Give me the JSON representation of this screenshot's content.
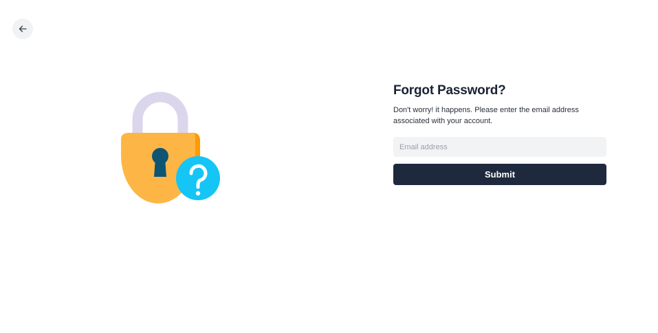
{
  "nav": {
    "back_icon": "arrow-left-icon"
  },
  "illustration": {
    "icon": "padlock-question-icon",
    "colors": {
      "shackle": "#dcd6ec",
      "body": "#fdb645",
      "body_shade": "#ff9a00",
      "keyhole": "#0e5574",
      "badge": "#14c5f5",
      "badge_mark": "#ffffff"
    }
  },
  "form": {
    "title": "Forgot Password?",
    "description": "Don't worry! it happens. Please enter the email address associated with your account.",
    "email": {
      "placeholder": "Email address",
      "value": ""
    },
    "submit_label": "Submit"
  },
  "colors": {
    "primary_button": "#1e293d",
    "input_background": "#f2f3f5",
    "back_button_background": "#f1f2f4"
  }
}
